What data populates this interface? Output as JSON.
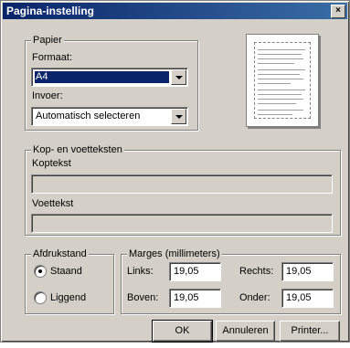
{
  "window": {
    "title": "Pagina-instelling",
    "close_glyph": "×"
  },
  "papier": {
    "legend": "Papier",
    "formaat_label": "Formaat:",
    "formaat_value": "A4",
    "invoer_label": "Invoer:",
    "invoer_value": "Automatisch selecteren"
  },
  "kop": {
    "legend": "Kop- en voetteksten",
    "koptekst_label": "Koptekst",
    "koptekst_value": "",
    "voettekst_label": "Voettekst",
    "voettekst_value": ""
  },
  "afdrukstand": {
    "legend": "Afdrukstand",
    "staand_label": "Staand",
    "liggend_label": "Liggend",
    "selected": "Staand"
  },
  "marges": {
    "legend": "Marges (millimeters)",
    "links_label": "Links:",
    "links_value": "19,05",
    "rechts_label": "Rechts:",
    "rechts_value": "19,05",
    "boven_label": "Boven:",
    "boven_value": "19,05",
    "onder_label": "Onder:",
    "onder_value": "19,05"
  },
  "buttons": {
    "ok": "OK",
    "annuleren": "Annuleren",
    "printer": "Printer..."
  }
}
